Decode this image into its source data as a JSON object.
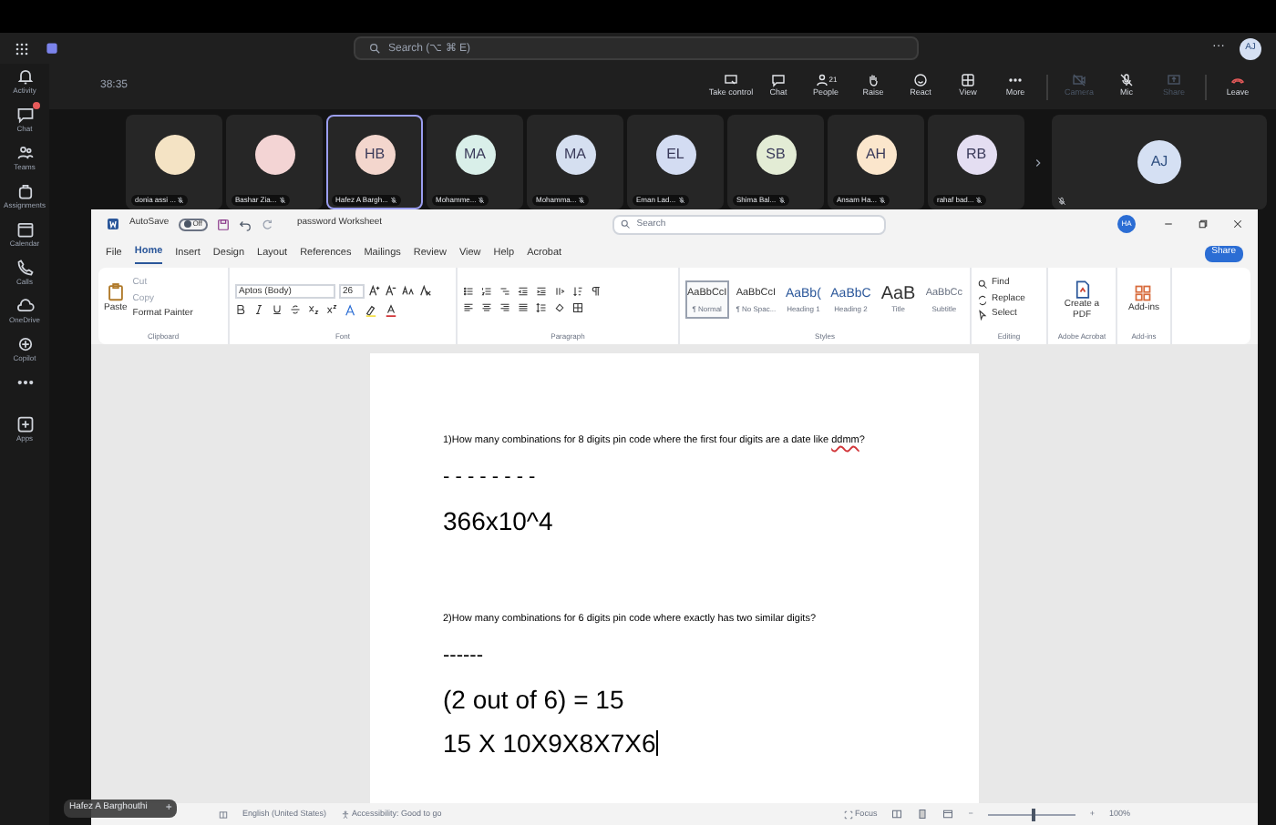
{
  "teams_header": {
    "search_placeholder": "Search (⌥ ⌘ E)",
    "more": "···",
    "avatar": "AJ"
  },
  "sidebar": [
    {
      "label": "Activity",
      "kind": "bell",
      "badge": false
    },
    {
      "label": "Chat",
      "kind": "chat",
      "badge": true
    },
    {
      "label": "Teams",
      "kind": "teams",
      "badge": false
    },
    {
      "label": "Assignments",
      "kind": "bag",
      "badge": false
    },
    {
      "label": "Calendar",
      "kind": "calendar",
      "badge": false
    },
    {
      "label": "Calls",
      "kind": "phone",
      "badge": false
    },
    {
      "label": "OneDrive",
      "kind": "cloud",
      "badge": false
    },
    {
      "label": "Copilot",
      "kind": "copilot",
      "badge": false
    },
    {
      "kind": "more",
      "badge": false
    },
    {
      "label": "Apps",
      "kind": "apps",
      "badge": false
    }
  ],
  "meeting": {
    "timer": "38:35",
    "controls": [
      {
        "label": "Take control",
        "kind": "screen",
        "disabled": false
      },
      {
        "label": "Chat",
        "kind": "chat",
        "disabled": false
      },
      {
        "label": "People",
        "kind": "people",
        "disabled": false,
        "count": "21"
      },
      {
        "label": "Raise",
        "kind": "hand",
        "disabled": false
      },
      {
        "label": "React",
        "kind": "smile",
        "disabled": false
      },
      {
        "label": "View",
        "kind": "grid",
        "disabled": false
      },
      {
        "label": "More",
        "kind": "dots",
        "disabled": false
      },
      {
        "label": "Camera",
        "kind": "camera",
        "disabled": true
      },
      {
        "label": "Mic",
        "kind": "mic",
        "disabled": false
      },
      {
        "label": "Share",
        "kind": "share",
        "disabled": true
      },
      {
        "label": "Leave",
        "kind": "leave",
        "disabled": false
      }
    ]
  },
  "participants": [
    {
      "name": "donia assi ...",
      "color": "#f4e3c4",
      "selected": false
    },
    {
      "name": "Bashar Zia...",
      "color": "#f3d4d4",
      "selected": false
    },
    {
      "name": "Hafez A Bargh...",
      "initials": "HB",
      "color": "#f3d6cd",
      "selected": true
    },
    {
      "name": "Mohamme...",
      "initials": "MA",
      "color": "#d9efe9",
      "selected": false
    },
    {
      "name": "Mohamma...",
      "initials": "MA",
      "color": "#d5dff0",
      "selected": false
    },
    {
      "name": "Eman Lad...",
      "initials": "EL",
      "color": "#d3dcf2",
      "selected": false
    },
    {
      "name": "Shima Bal...",
      "initials": "SB",
      "color": "#e3ecd5",
      "selected": false
    },
    {
      "name": "Ansam Ha...",
      "initials": "AH",
      "color": "#fbe6cc",
      "selected": false
    },
    {
      "name": "rahaf bad...",
      "initials": "RB",
      "color": "#e4def2",
      "selected": false
    }
  ],
  "featured": {
    "initials": "AJ",
    "color": "#d5e0f3"
  },
  "word": {
    "autosave_label": "AutoSave",
    "autosave": "Off",
    "doc_title": "password Worksheet",
    "search_placeholder": "Search",
    "avatar": "HA",
    "tabs": [
      {
        "label": "File",
        "selected": false
      },
      {
        "label": "Home",
        "selected": true
      },
      {
        "label": "Insert",
        "selected": false
      },
      {
        "label": "Design",
        "selected": false
      },
      {
        "label": "Layout",
        "selected": false
      },
      {
        "label": "References",
        "selected": false
      },
      {
        "label": "Mailings",
        "selected": false
      },
      {
        "label": "Review",
        "selected": false
      },
      {
        "label": "View",
        "selected": false
      },
      {
        "label": "Help",
        "selected": false
      },
      {
        "label": "Acrobat",
        "selected": false
      }
    ],
    "share": "Share",
    "clipboard": {
      "paste": "Paste",
      "cut": "Cut",
      "copy": "Copy",
      "format_painter": "Format Painter",
      "group": "Clipboard"
    },
    "font": {
      "name": "Aptos (Body)",
      "size": "26",
      "group": "Font"
    },
    "paragraph": {
      "group": "Paragraph"
    },
    "styles": {
      "group": "Styles",
      "items": [
        {
          "sample": "AaBbCcI",
          "label": "¶ Normal",
          "selected": true
        },
        {
          "sample": "AaBbCcI",
          "label": "¶ No Spac...",
          "selected": false
        },
        {
          "sample": "AaBb(",
          "label": "Heading 1",
          "selected": false
        },
        {
          "sample": "AaBbC",
          "label": "Heading 2",
          "selected": false
        },
        {
          "sample": "AaB",
          "label": "Title",
          "selected": false
        },
        {
          "sample": "AaBbCc",
          "label": "Subtitle",
          "selected": false
        }
      ]
    },
    "editing": {
      "group": "Editing",
      "items": [
        "Find",
        "Replace",
        "Select"
      ]
    },
    "acrobat": {
      "group": "Adobe Acrobat",
      "button": "Create a PDF"
    },
    "addins": {
      "group": "Add-ins",
      "button": "Add-ins"
    },
    "document": [
      {
        "kind": "question",
        "runs": [
          {
            "text": "1)How many combinations for 8 digits pin code where the first four digits are a date like "
          },
          {
            "text": "ddmm",
            "misspelled": true
          },
          {
            "text": "?"
          }
        ]
      },
      {
        "kind": "rule",
        "text": "- - - - - - - -"
      },
      {
        "kind": "answer",
        "text": "366x10^4",
        "cursor": false
      },
      {
        "kind": "gap"
      },
      {
        "kind": "question",
        "runs": [
          {
            "text": "2)How many combinations for 6 digits pin code where exactly has two similar digits?"
          }
        ]
      },
      {
        "kind": "rule",
        "text": "------"
      },
      {
        "kind": "answer",
        "text": "(2 out of 6) = 15",
        "cursor": false
      },
      {
        "kind": "answer",
        "text": "15 X 10X9X8X7X6",
        "cursor": true
      }
    ],
    "status": {
      "language": "English (United States)",
      "accessibility": "Accessibility: Good to go",
      "focus": "Focus",
      "zoom_out": "−",
      "zoom_in": "+",
      "zoom": "100%",
      "level": 0.5
    }
  },
  "presenter_tag": {
    "name": "Hafez A Barghouthi",
    "action": "+"
  }
}
